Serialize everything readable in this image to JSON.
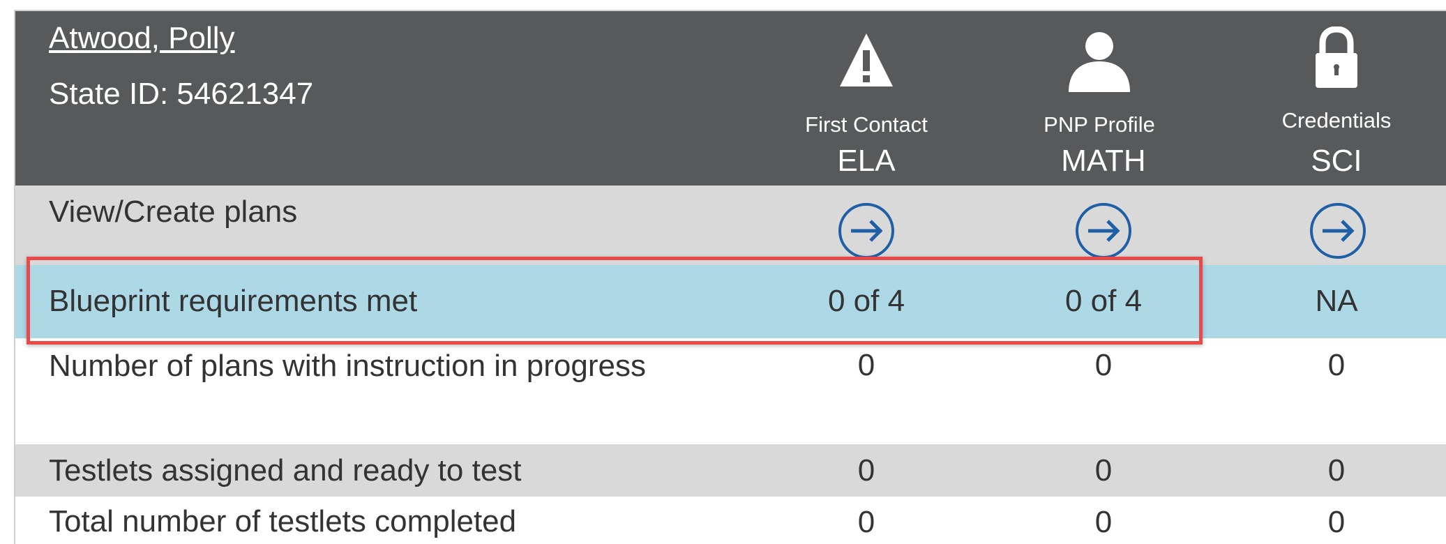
{
  "student": {
    "name": "Atwood, Polly",
    "state_id_label": "State ID:",
    "state_id": "54621347"
  },
  "header_icons": [
    {
      "label": "First Contact",
      "icon": "warning-icon"
    },
    {
      "label": "PNP Profile",
      "icon": "person-icon"
    },
    {
      "label": "Credentials",
      "icon": "lock-icon"
    }
  ],
  "subjects": [
    "ELA",
    "MATH",
    "SCI"
  ],
  "rows": [
    {
      "label": "View/Create plans",
      "values": [
        "arrow-circle-icon",
        "arrow-circle-icon",
        "arrow-circle-icon"
      ]
    },
    {
      "label": "Blueprint requirements met",
      "values": [
        "0 of 4",
        "0 of 4",
        "NA"
      ]
    },
    {
      "label": "Number of plans with instruction in progress",
      "values": [
        "0",
        "0",
        "0"
      ]
    },
    {
      "label": "Testlets assigned and ready to test",
      "values": [
        "0",
        "0",
        "0"
      ]
    },
    {
      "label": "Total number of testlets completed",
      "values": [
        "0",
        "0",
        "0"
      ]
    }
  ],
  "colors": {
    "header_bg": "#58595b",
    "row_gray": "#d9d9d9",
    "row_highlight": "#add8e6",
    "arrow_blue": "#1f5fa6",
    "highlight_border": "#e84a4a"
  }
}
